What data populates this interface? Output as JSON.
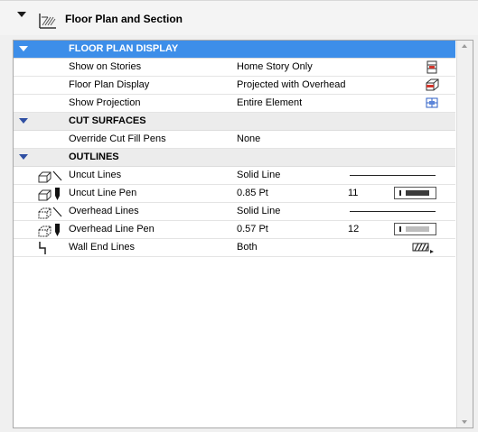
{
  "header": {
    "title": "Floor Plan and Section",
    "icon": "floor-plan-section-icon"
  },
  "sections": {
    "floor_plan_display": {
      "label": "FLOOR PLAN DISPLAY",
      "rows": {
        "show_on_stories": {
          "name": "Show on Stories",
          "value": "Home Story Only",
          "icon": "home-story-icon"
        },
        "floor_plan_display": {
          "name": "Floor Plan Display",
          "value": "Projected with Overhead",
          "icon": "projected-overhead-icon"
        },
        "show_projection": {
          "name": "Show Projection",
          "value": "Entire Element",
          "icon": "entire-element-icon"
        }
      }
    },
    "cut_surfaces": {
      "label": "CUT SURFACES",
      "rows": {
        "override_cut_fill_pens": {
          "name": "Override Cut Fill Pens",
          "value": "None"
        }
      }
    },
    "outlines": {
      "label": "OUTLINES",
      "rows": {
        "uncut_lines": {
          "name": "Uncut Lines",
          "value": "Solid Line"
        },
        "uncut_line_pen": {
          "name": "Uncut Line Pen",
          "value": "0.85 Pt",
          "pen_number": "11",
          "pen_color": "#3a3a3a"
        },
        "overhead_lines": {
          "name": "Overhead Lines",
          "value": "Solid Line"
        },
        "overhead_line_pen": {
          "name": "Overhead Line Pen",
          "value": "0.57 Pt",
          "pen_number": "12",
          "pen_color": "#bdbdbd"
        },
        "wall_end_lines": {
          "name": "Wall End Lines",
          "value": "Both",
          "icon": "wall-end-lines-icon"
        }
      }
    }
  },
  "colors": {
    "selection": "#3d8ee9",
    "section_triangle": "#2f4fa3"
  }
}
